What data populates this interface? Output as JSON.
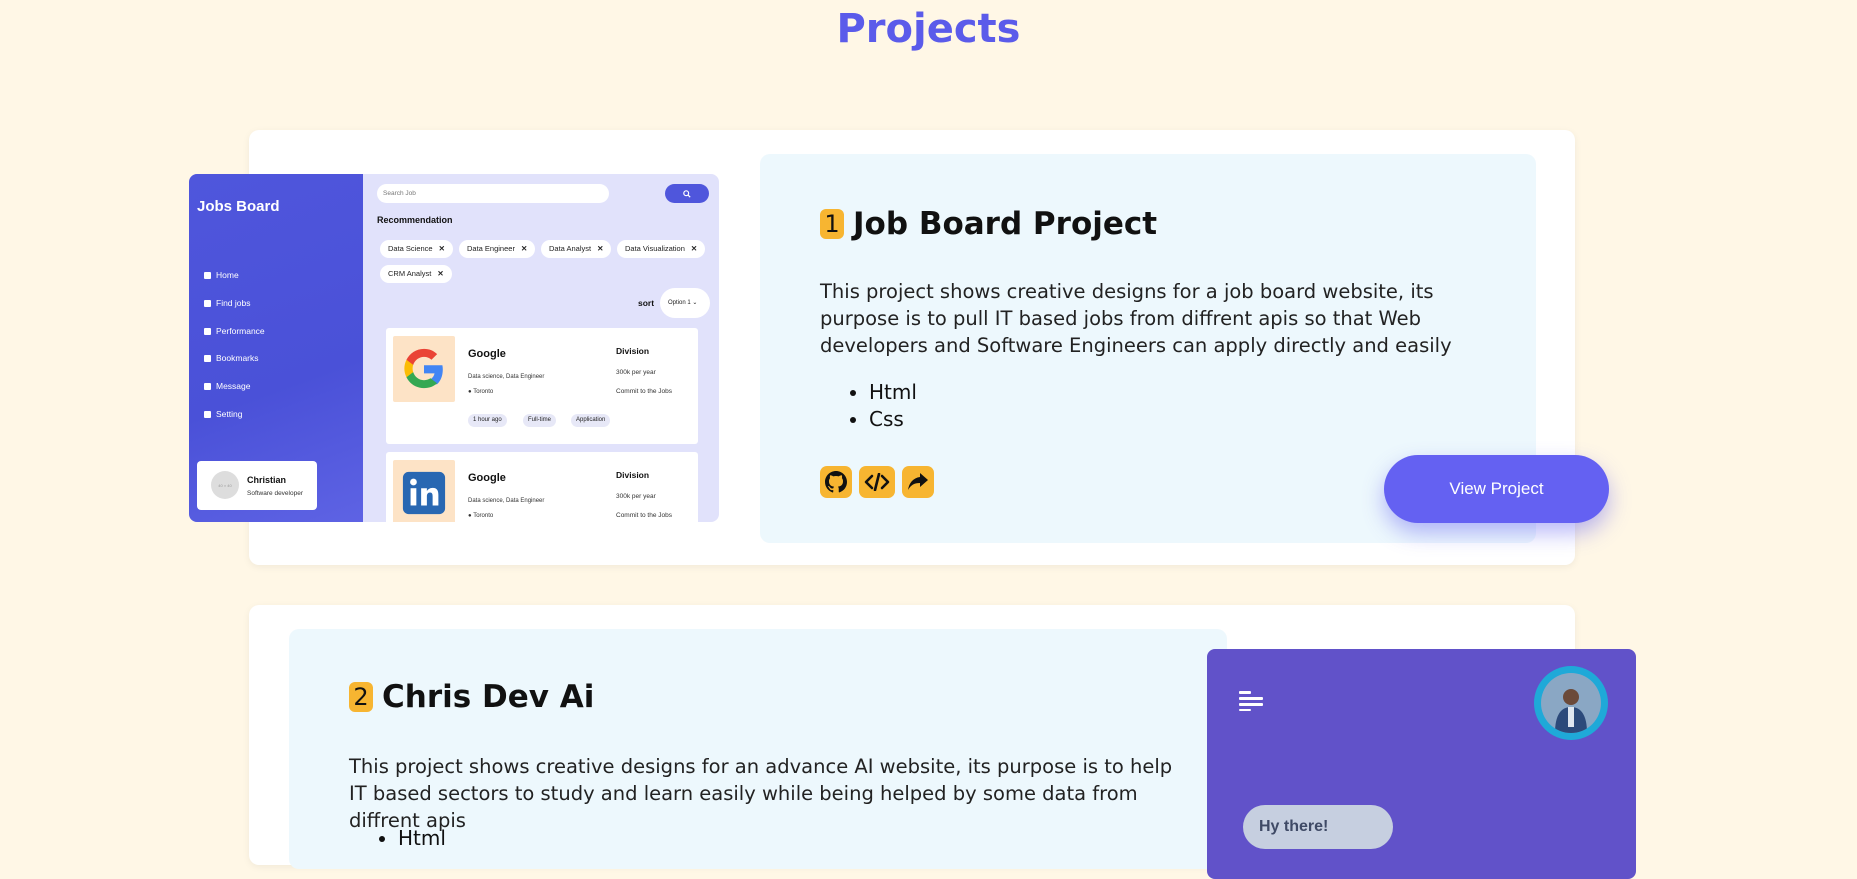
{
  "page": {
    "title": "Projects"
  },
  "projects": [
    {
      "number": "1",
      "title": "Job Board Project",
      "description": "This project shows creative designs for a job board website, its purpose is to pull IT based jobs from diffrent apis so that Web developers and Software Engineers can apply directly and easily",
      "tech": [
        "Html",
        "Css"
      ],
      "view_label": "View Project",
      "links": [
        "github-icon",
        "code-icon",
        "share-icon"
      ],
      "preview": {
        "logo": "Jobs Board",
        "nav": [
          "Home",
          "Find jobs",
          "Performance",
          "Bookmarks",
          "Message",
          "Setting"
        ],
        "search_placeholder": "Search Job",
        "recommendation": "Recommendation",
        "chips": [
          "Data Science",
          "Data Engineer",
          "Data Analyst",
          "Data Visualization",
          "CRM Analyst"
        ],
        "sort_label": "sort",
        "sort_option": "Option 1",
        "user": {
          "avatar": "40 × 40",
          "name": "Christian",
          "role": "Software developer"
        },
        "jobs": [
          {
            "company": "Google",
            "role": "Data science, Data Engineer",
            "location": "Toronto",
            "division": "Division",
            "salary": "300k per year",
            "commit": "Commit to the Jobs",
            "tags": [
              "1 hour ago",
              "Full-time",
              "Application"
            ]
          },
          {
            "company": "Google",
            "role": "Data science, Data Engineer",
            "location": "Toronto",
            "division": "Division",
            "salary": "300k per year",
            "commit": "Commit to the Jobs"
          }
        ]
      }
    },
    {
      "number": "2",
      "title": "Chris Dev Ai",
      "description": "This project shows creative designs for an advance AI website, its purpose is to help IT based sectors to study and learn easily while being helped by some data from diffrent apis",
      "tech": [
        "Html"
      ],
      "preview": {
        "bubble": "Hy there!"
      }
    }
  ],
  "colors": {
    "accent": "#5b5bea",
    "badge": "#f7b531",
    "button": "#6461f2",
    "background": "#fff7e6"
  }
}
